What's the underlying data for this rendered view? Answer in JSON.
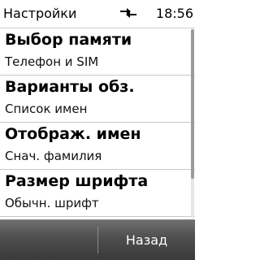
{
  "status_bar": {
    "title": "Настройки",
    "time": "18:56",
    "icon": "usb-connection-icon"
  },
  "list": {
    "items": [
      {
        "label": "Выбор памяти",
        "value": "Телефон и SIM"
      },
      {
        "label": "Варианты обз.",
        "value": "Список имен"
      },
      {
        "label": "Отображ. имен",
        "value": "Снач. фамилия"
      },
      {
        "label": "Размер шрифта",
        "value": "Обычн. шрифт"
      }
    ]
  },
  "softkeys": {
    "right_label": "Назад"
  },
  "colors": {
    "softkey_bar": "#4e4e4e",
    "divider": "#c8c8c8"
  }
}
